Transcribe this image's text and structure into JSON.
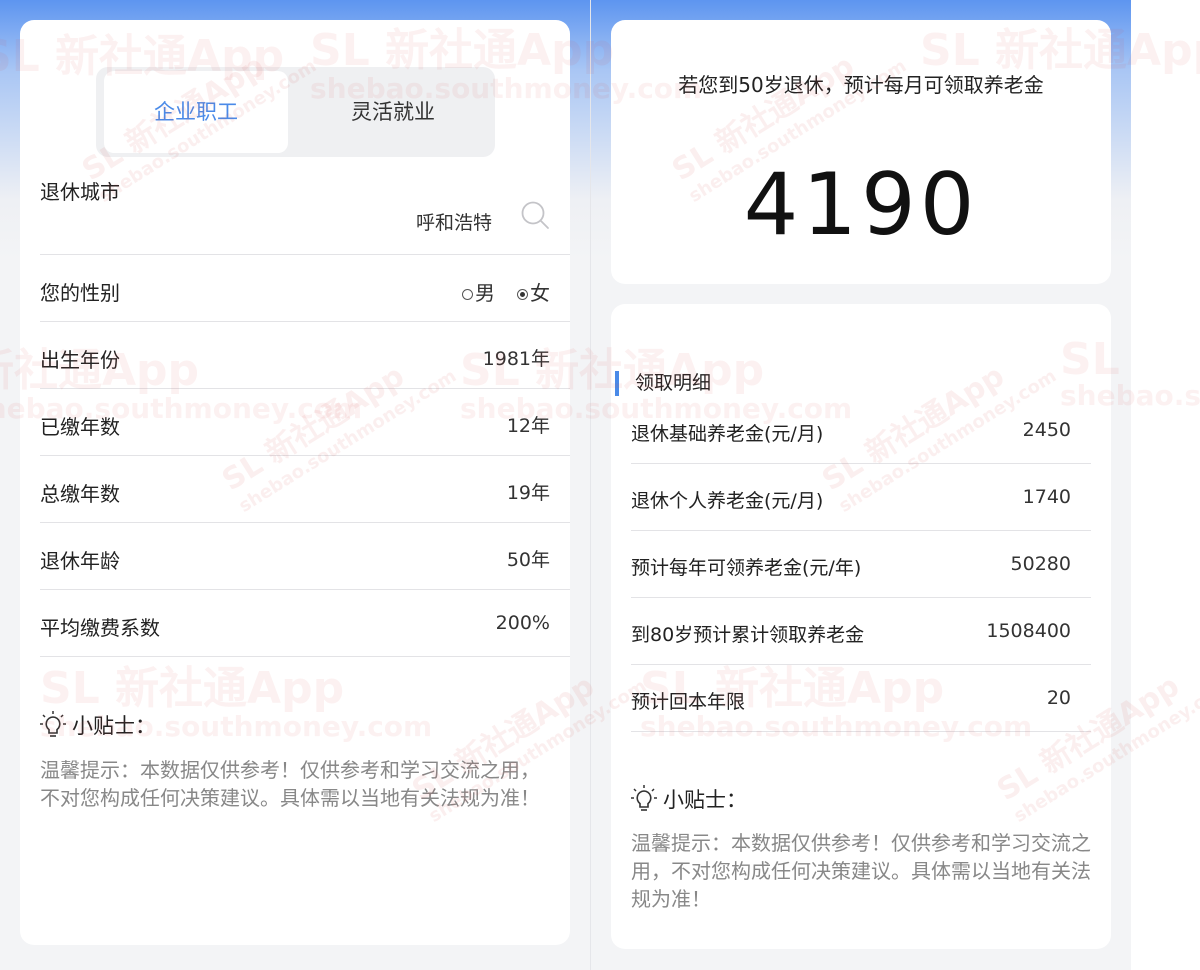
{
  "left": {
    "tabs": [
      {
        "label": "企业职工",
        "active": true
      },
      {
        "label": "灵活就业",
        "active": false
      }
    ],
    "city": {
      "label": "退休城市",
      "value": "呼和浩特"
    },
    "gender": {
      "label": "您的性别",
      "options": [
        {
          "label": "男",
          "checked": false
        },
        {
          "label": "女",
          "checked": true
        }
      ]
    },
    "rows": [
      {
        "label": "出生年份",
        "value": "1981年"
      },
      {
        "label": "已缴年数",
        "value": "12年"
      },
      {
        "label": "总缴年数",
        "value": "19年"
      },
      {
        "label": "退休年龄",
        "value": "50年"
      },
      {
        "label": "平均缴费系数",
        "value": "200%"
      }
    ],
    "tips": {
      "title": "小贴士：",
      "text": "温馨提示：本数据仅供参考！仅供参考和学习交流之用，不对您构成任何决策建议。具体需以当地有关法规为准！"
    }
  },
  "right": {
    "result": {
      "headline": "若您到50岁退休，预计每月可领取养老金",
      "amount": "4190"
    },
    "detail": {
      "title": "领取明细",
      "rows": [
        {
          "label": "退休基础养老金(元/月)",
          "value": "2450"
        },
        {
          "label": "退休个人养老金(元/月)",
          "value": "1740"
        },
        {
          "label": "预计每年可领养老金(元/年)",
          "value": "50280"
        },
        {
          "label": "到80岁预计累计领取养老金",
          "value": "1508400"
        },
        {
          "label": "预计回本年限",
          "value": "20"
        }
      ]
    },
    "tips": {
      "title": "小贴士：",
      "text": "温馨提示：本数据仅供参考！仅供参考和学习交流之用，不对您构成任何决策建议。具体需以当地有关法规为准！"
    }
  },
  "watermark": {
    "brand": "新社通App",
    "site": "shebao.southmoney.com",
    "logo": "SL"
  },
  "colors": {
    "accent": "#4a8ae8",
    "header_blue": "#5d95f0",
    "divider": "#e3e3e6"
  }
}
